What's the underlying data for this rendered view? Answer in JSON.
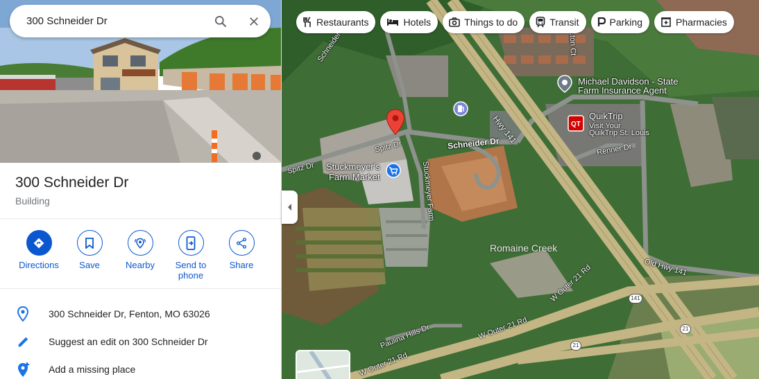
{
  "search": {
    "query": "300 Schneider Dr"
  },
  "place": {
    "title": "300 Schneider Dr",
    "type": "Building"
  },
  "actions": [
    {
      "label": "Directions",
      "icon": "directions-icon"
    },
    {
      "label": "Save",
      "icon": "bookmark-icon"
    },
    {
      "label": "Nearby",
      "icon": "nearby-icon"
    },
    {
      "label": "Send to phone",
      "icon": "send-to-phone-icon"
    },
    {
      "label": "Share",
      "icon": "share-icon"
    }
  ],
  "info": [
    {
      "text": "300 Schneider Dr, Fenton, MO 63026",
      "icon": "location-pin-icon"
    },
    {
      "text": "Suggest an edit on 300 Schneider Dr",
      "icon": "pencil-icon"
    },
    {
      "text": "Add a missing place",
      "icon": "add-place-icon"
    }
  ],
  "chips": [
    {
      "label": "Restaurants",
      "icon": "restaurant-icon"
    },
    {
      "label": "Hotels",
      "icon": "hotel-icon"
    },
    {
      "label": "Things to do",
      "icon": "camera-icon"
    },
    {
      "label": "Transit",
      "icon": "transit-icon"
    },
    {
      "label": "Parking",
      "icon": "parking-icon"
    },
    {
      "label": "Pharmacies",
      "icon": "pharmacy-icon"
    }
  ],
  "map": {
    "labels": {
      "stuckmeyers": "Stuckmeyer's\nFarm Market",
      "michael1": "Michael Davidson - State",
      "michael2": "Farm Insurance Agent",
      "quiktrip": "QuikTrip",
      "quiktrip_sub1": "Visit Your",
      "quiktrip_sub2": "QuikTrip St. Louis",
      "schneider": "Schneider Dr",
      "spitz1": "Spitz Dr",
      "spitz2": "Spitz Dr",
      "hwy141": "Hwy 141",
      "renner": "Renner Dr",
      "romaine": "Romaine Creek",
      "oldhwy": "Old Hwy 141",
      "wouter1": "W Outer 21 Rd",
      "wouter2": "W Outer 21 Rd",
      "wouter3": "W Outer 21 Rd",
      "paulina": "Paulina Hills Dr",
      "stuckmeyer_farm": "Stuckmeyer Farm",
      "schneider_top": "Schneider",
      "ct": "...ton Ct",
      "shield141": "141",
      "shield21a": "21",
      "shield21b": "21"
    },
    "colors": {
      "pin": "#ea4335",
      "poi_blue": "#1a73e8",
      "poi_gas": "#7b86d6",
      "quiktrip": "#d50000"
    }
  }
}
